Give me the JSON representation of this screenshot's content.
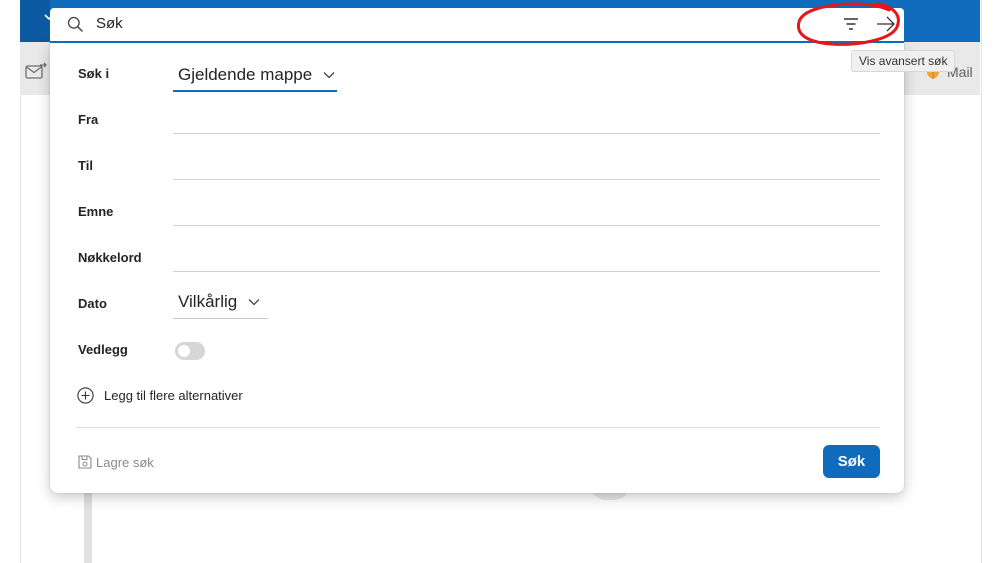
{
  "search": {
    "query": "Søk",
    "filter_tooltip": "Vis avansert søk"
  },
  "background": {
    "mail_label": "Mail"
  },
  "advanced": {
    "rows": {
      "search_in": {
        "label": "Søk i",
        "value": "Gjeldende mappe"
      },
      "from": {
        "label": "Fra",
        "value": ""
      },
      "to": {
        "label": "Til",
        "value": ""
      },
      "subject": {
        "label": "Emne",
        "value": ""
      },
      "keywords": {
        "label": "Nøkkelord",
        "value": ""
      },
      "date": {
        "label": "Dato",
        "value": "Vilkårlig"
      },
      "attachments": {
        "label": "Vedlegg",
        "enabled": false
      }
    },
    "add_more_label": "Legg til flere alternativer",
    "save_search_label": "Lagre søk",
    "submit_label": "Søk"
  },
  "colors": {
    "accent": "#0f6cbd",
    "annotation": "#e8161b"
  },
  "icons": [
    "search-icon",
    "filter-icon",
    "arrow-right-icon",
    "chevron-down-icon",
    "plus-circle-icon",
    "save-icon",
    "shield-icon",
    "mail-icon"
  ]
}
